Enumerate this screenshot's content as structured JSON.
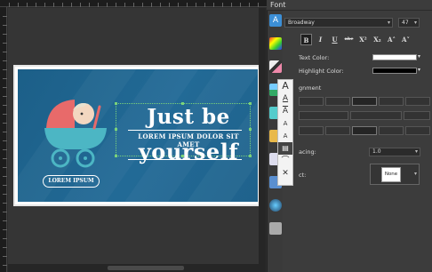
{
  "panel": {
    "title": "Font",
    "font_family": "Broadway",
    "font_size": "47",
    "style_buttons": [
      "B",
      "I",
      "U",
      "abc",
      "X²",
      "X₂",
      "A˄",
      "A˅"
    ],
    "text_color_label": "Text Color:",
    "highlight_color_label": "Highlight Color:",
    "text_color": "#ffffff",
    "highlight_color": "#000000",
    "alignment_label": "gnment",
    "spacing_label": "acing:",
    "spacing_value": "1.0",
    "effect_label": "ct:",
    "effect_value": "None"
  },
  "floating_tools": {
    "items": [
      "A",
      "A",
      "A",
      "A",
      "A",
      "A",
      "▤",
      "⌒",
      "✕"
    ]
  },
  "design": {
    "headline_line1": "Just be",
    "subline": "LOREM IPSUM DOLOR SIT AMET",
    "headline_line2": "yourself",
    "pill_text": "LOREM IPSUM"
  },
  "colors": {
    "card_bg": "#1f6490",
    "stroller_body": "#4cb6c4",
    "stroller_hood": "#e86a6a",
    "accent": "#7ad27a"
  },
  "side_icons": [
    "text-tool-icon",
    "shapes-icon",
    "pen-icon",
    "image-icon",
    "color-icon",
    "folder-icon",
    "document-icon",
    "layers-icon",
    "globe-icon",
    "link-icon"
  ]
}
